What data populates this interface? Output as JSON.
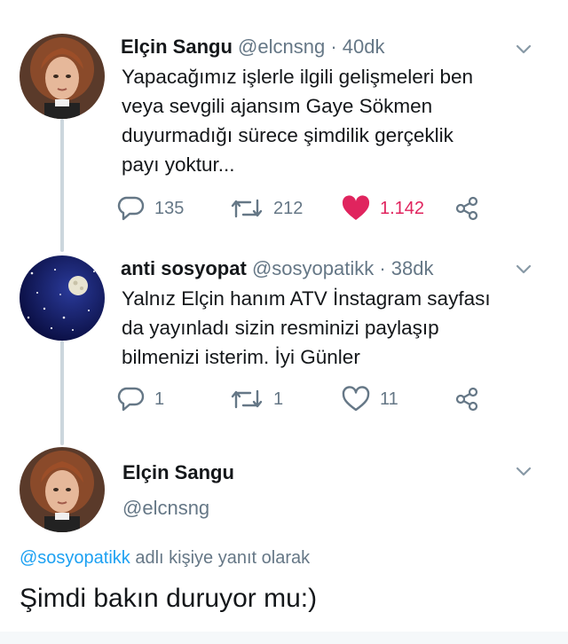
{
  "tweets": [
    {
      "name": "Elçin Sangu",
      "handle": "@elcnsng",
      "separator": "·",
      "time": "40dk",
      "text_lines": [
        "Yapacağımız işlerle ilgili gelişmeleri ben",
        "veya sevgili ajansım Gaye Sökmen",
        "duyurmadığı sürece şimdilik gerçeklik",
        "payı yoktur..."
      ],
      "replies": "135",
      "retweets": "212",
      "likes": "1.142",
      "liked": true
    },
    {
      "name": "anti sosyopat",
      "handle": "@sosyopatikk",
      "separator": "·",
      "time": "38dk",
      "text_lines": [
        "Yalnız Elçin hanım ATV İnstagram sayfası",
        "da yayınladı sizin resminizi paylaşıp",
        "bilmenizi isterim. İyi Günler"
      ],
      "replies": "1",
      "retweets": "1",
      "likes": "11",
      "liked": false
    }
  ],
  "main_tweet": {
    "name": "Elçin Sangu",
    "handle": "@elcnsng",
    "reply_mention": "@sosyopatikk",
    "reply_suffix": "adlı kişiye yanıt olarak",
    "text": "Şimdi bakın duruyor mu:)"
  },
  "icons": {
    "reply": "reply-icon",
    "retweet": "retweet-icon",
    "like": "heart-icon",
    "share": "share-icon",
    "caret": "chevron-down-icon"
  },
  "colors": {
    "name": "#14171a",
    "muted": "#657786",
    "like_active": "#e0245e",
    "mention": "#1da1f2",
    "thread_line": "#ccd6dd"
  }
}
